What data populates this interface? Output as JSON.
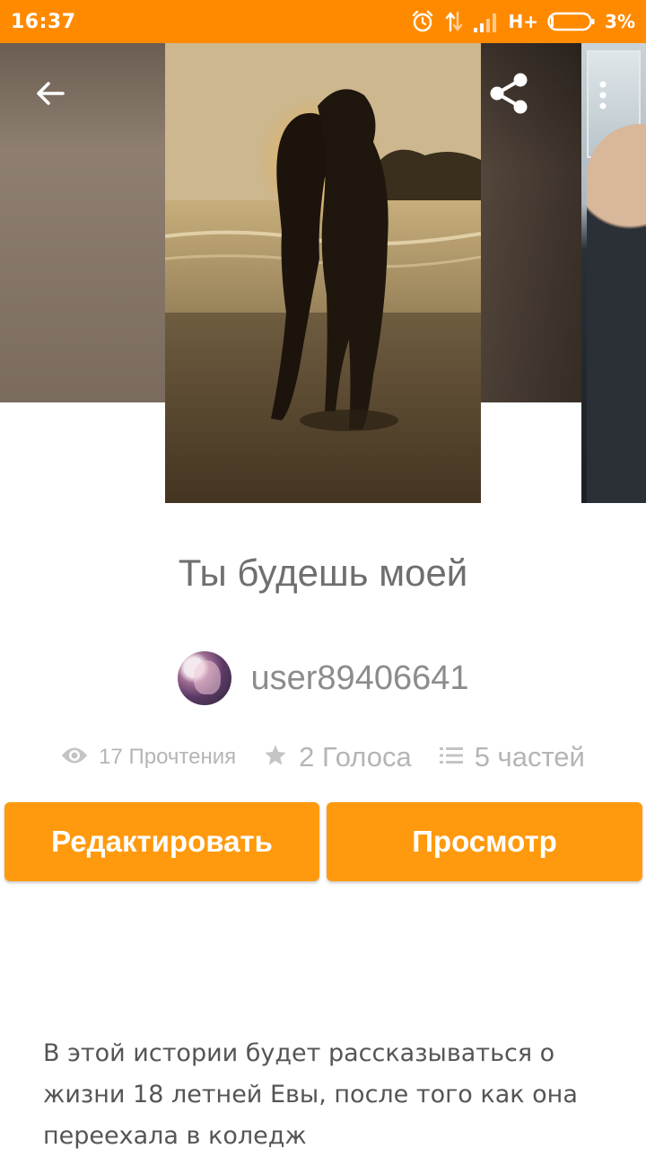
{
  "status_bar": {
    "time": "16:37",
    "network": "H+",
    "battery": "3%",
    "icons": [
      "alarm-icon",
      "data-activity-icon",
      "signal-icon",
      "battery-icon"
    ]
  },
  "toolbar": {
    "back_icon": "arrow-back-icon",
    "share_icon": "share-icon",
    "more_icon": "more-vert-icon"
  },
  "story": {
    "title": "Ты будешь моей",
    "author": "user89406641",
    "stats": {
      "reads": "17 Прочтения",
      "votes": "2 Голоса",
      "parts": "5 частей"
    },
    "description": "В этой истории будет рассказываться о жизни 18 летней Евы, после того как она переехала в коледж"
  },
  "buttons": {
    "edit": "Редактировать",
    "view": "Просмотр"
  },
  "colors": {
    "accent": "#ff8a00",
    "button": "#ff9a0e",
    "text_muted": "#8c8c8c"
  }
}
